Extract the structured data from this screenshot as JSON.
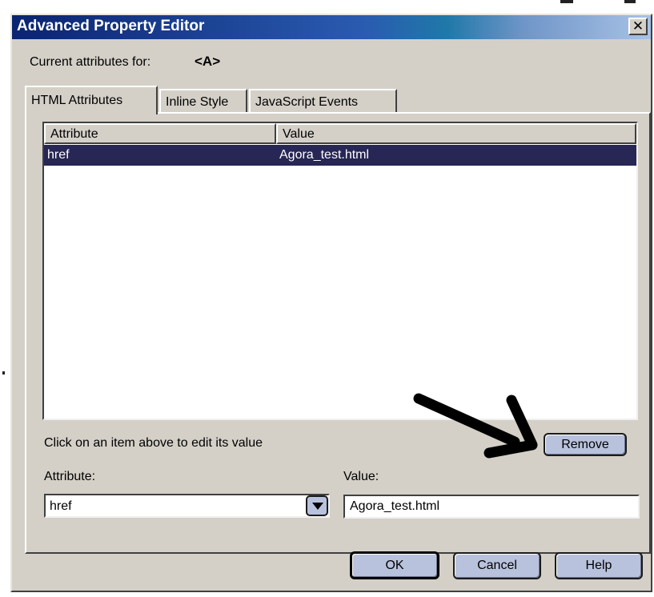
{
  "dialog": {
    "title": "Advanced Property Editor",
    "close_glyph": "✕"
  },
  "current": {
    "label": "Current attributes for:",
    "value": "<A>"
  },
  "tabs": [
    {
      "label": "HTML Attributes",
      "active": true
    },
    {
      "label": "Inline Style",
      "active": false
    },
    {
      "label": "JavaScript Events",
      "active": false
    }
  ],
  "table": {
    "columns": [
      "Attribute",
      "Value"
    ],
    "rows": [
      {
        "attribute": "href",
        "value": "Agora_test.html",
        "selected": true
      }
    ]
  },
  "hint": "Click on an item above to edit its value",
  "buttons": {
    "remove": "Remove",
    "ok": "OK",
    "cancel": "Cancel",
    "help": "Help"
  },
  "editor": {
    "attribute_label": "Attribute:",
    "attribute_value": "href",
    "value_label": "Value:",
    "value_value": "Agora_test.html"
  },
  "annotation": {
    "icon": "arrow-icon",
    "color": "#000000"
  },
  "colors": {
    "title_bar_start": "#0a2470",
    "selection": "#272654",
    "button_face": "#b8c2dc",
    "dialog_face": "#d4d0c8"
  }
}
